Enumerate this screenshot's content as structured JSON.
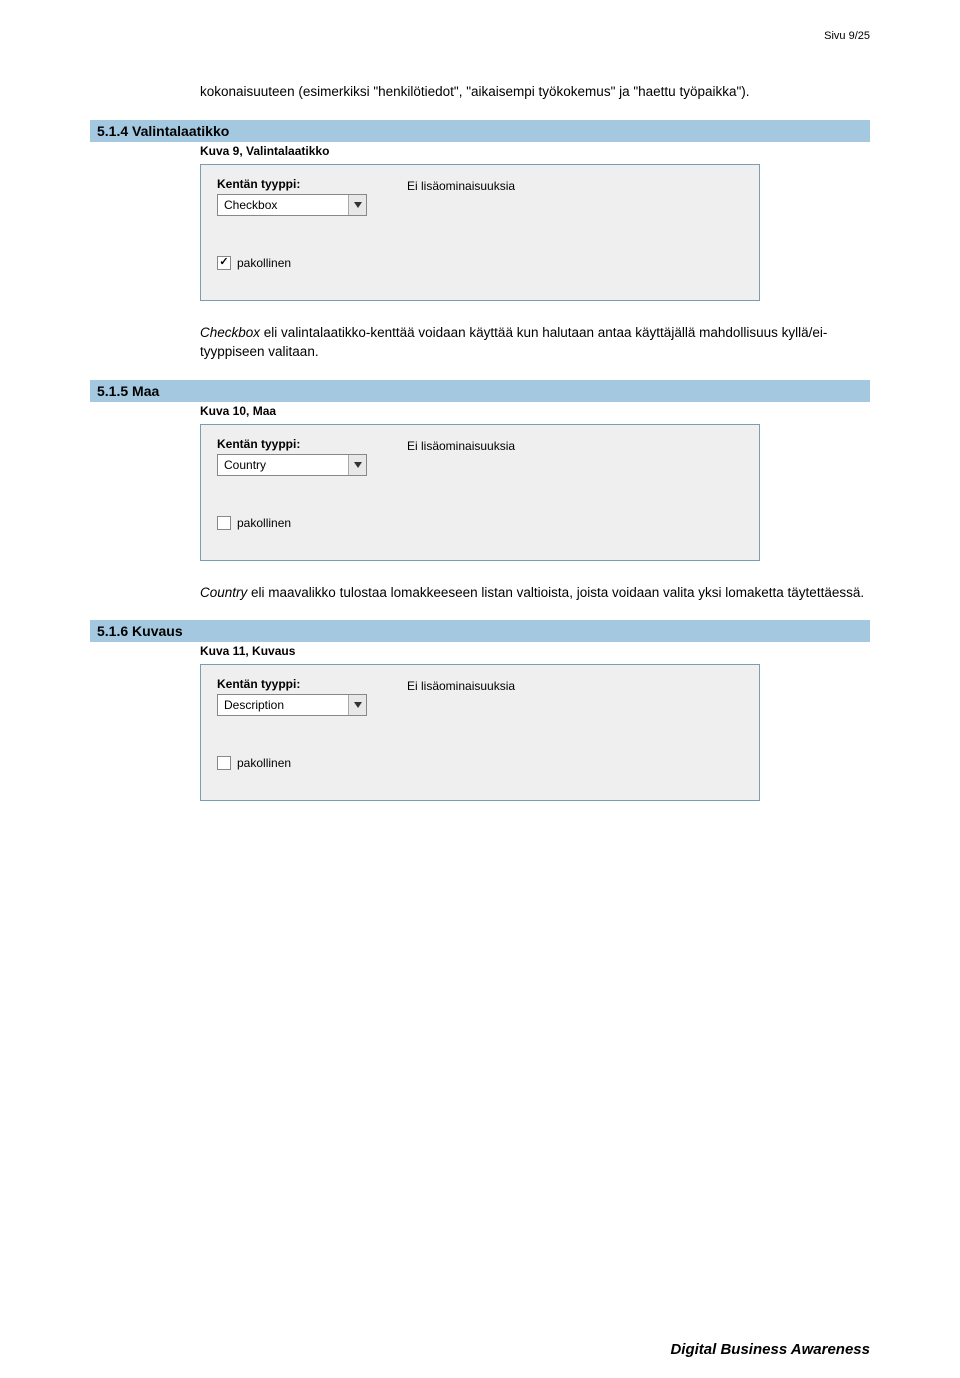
{
  "page_header": "Sivu 9/25",
  "intro_text": "kokonaisuuteen (esimerkiksi \"henkilötiedot\", \"aikaisempi työkokemus\" ja \"haettu työpaikka\").",
  "footer": "Digital Business Awareness",
  "common": {
    "fieldtype_label": "Kentän tyyppi:",
    "extra_label": "Ei lisäominaisuuksia",
    "mandatory_label": "pakollinen"
  },
  "sections": {
    "s514": {
      "heading": "5.1.4  Valintalaatikko",
      "caption": "Kuva 9, Valintalaatikko",
      "select_value": "Checkbox",
      "checked": true,
      "desc_prefix": "Checkbox",
      "desc_rest": " eli valintalaatikko-kenttää voidaan käyttää kun halutaan antaa käyttäjällä mahdollisuus kyllä/ei-tyyppiseen valitaan."
    },
    "s515": {
      "heading": "5.1.5  Maa",
      "caption": "Kuva 10, Maa",
      "select_value": "Country",
      "checked": false,
      "desc_prefix": "Country",
      "desc_rest": " eli maavalikko tulostaa lomakkeeseen listan valtioista, joista voidaan valita yksi lomaketta täytettäessä."
    },
    "s516": {
      "heading": "5.1.6  Kuvaus",
      "caption": "Kuva 11, Kuvaus",
      "select_value": "Description",
      "checked": false
    }
  }
}
